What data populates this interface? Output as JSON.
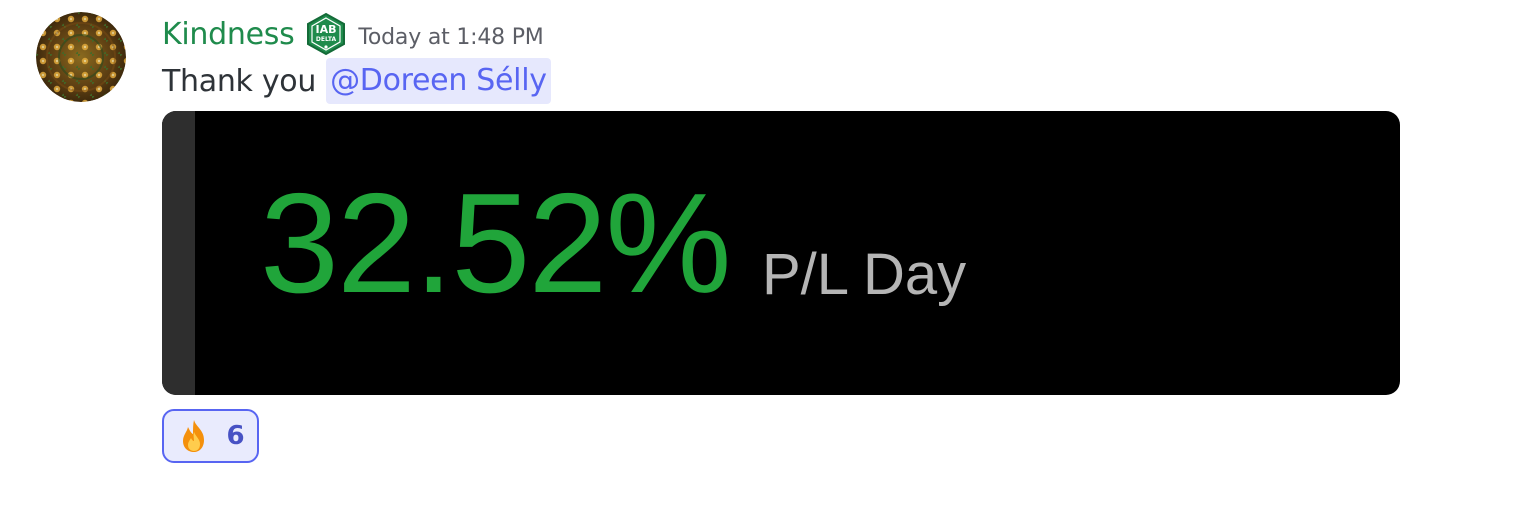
{
  "message": {
    "author": "Kindness",
    "role_badge": {
      "icon": "iab-delta-badge-icon",
      "text_top": "IAB",
      "text_bottom": "DELTA",
      "color": "#1f8b4c"
    },
    "timestamp": "Today at 1:48 PM",
    "text": "Thank you",
    "mention": "@Doreen Sélly"
  },
  "attachment": {
    "value": "32.52%",
    "label": "P/L Day",
    "value_color": "#20a53a",
    "label_color": "#b5b5b5"
  },
  "reactions": [
    {
      "emoji": "fire-icon",
      "count": "6"
    }
  ],
  "colors": {
    "author": "#1f8b4c",
    "mention_text": "#5865f2",
    "mention_bg": "#e6e8fd",
    "reaction_border": "#5865f2"
  }
}
